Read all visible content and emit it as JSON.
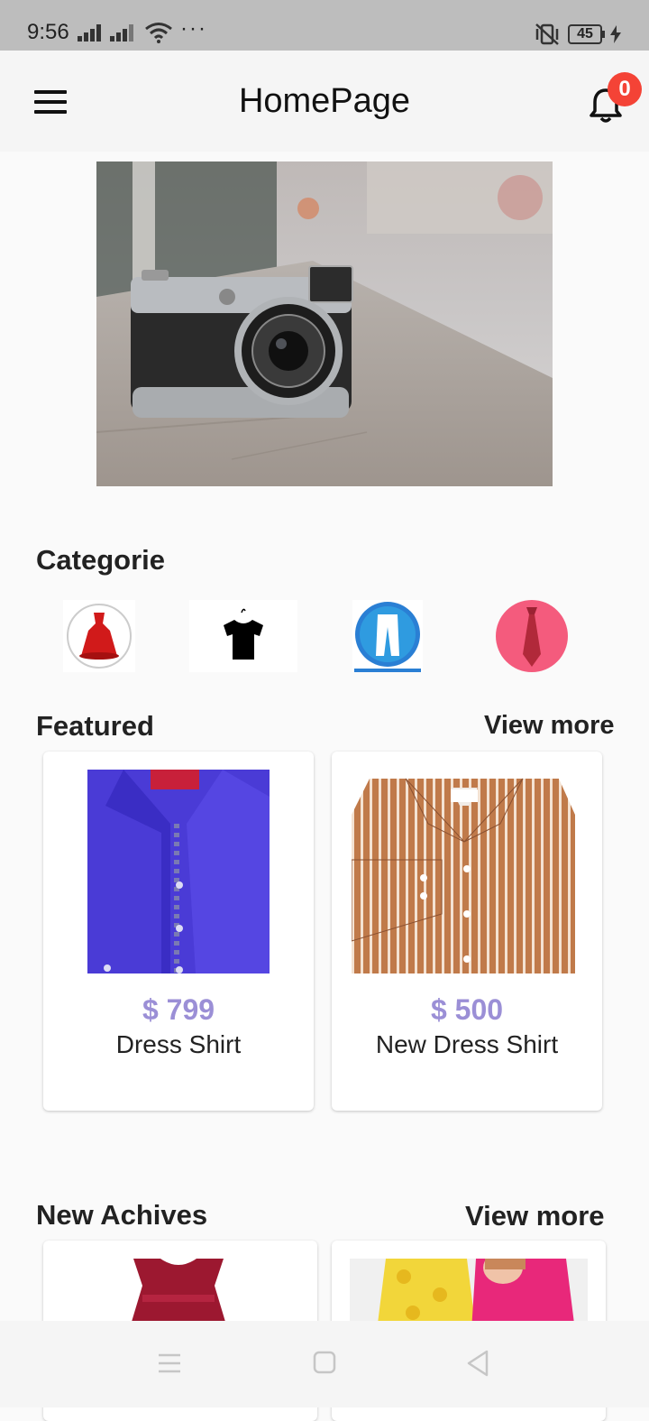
{
  "status_bar": {
    "time": "9:56",
    "dots": "···",
    "battery": "45"
  },
  "app_bar": {
    "title": "HomePage",
    "notification_count": "0"
  },
  "categories": {
    "title": "Categorie",
    "items": [
      {
        "icon": "dress-icon"
      },
      {
        "icon": "tshirt-icon"
      },
      {
        "icon": "pants-icon"
      },
      {
        "icon": "tie-icon"
      }
    ]
  },
  "featured": {
    "title": "Featured",
    "view_more": "View more",
    "products": [
      {
        "price": "$ 799",
        "name": "Dress Shirt"
      },
      {
        "price": "$ 500",
        "name": "New Dress Shirt"
      }
    ]
  },
  "new_arrivals": {
    "title": "New Achives",
    "view_more": "View more"
  },
  "colors": {
    "price": "#9b8fd6",
    "badge": "#f44336"
  }
}
